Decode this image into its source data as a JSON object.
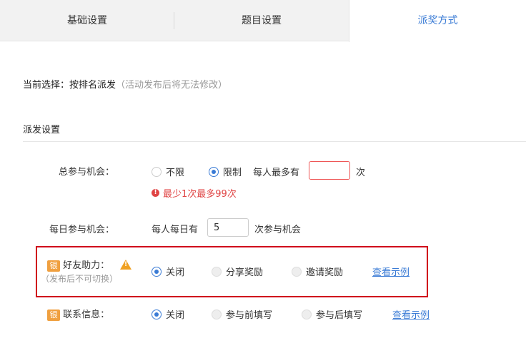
{
  "tabs": [
    "基础设置",
    "题目设置",
    "派奖方式"
  ],
  "current": {
    "prefix": "当前选择：按排名派发",
    "hint": "（活动发布后将无法修改）"
  },
  "section_title": "派发设置",
  "total": {
    "label": "总参与机会：",
    "opt_unlimited": "不限",
    "opt_limited": "限制",
    "per_person": "每人最多有",
    "value": "",
    "unit": "次",
    "error": "最少1次最多99次"
  },
  "daily": {
    "label": "每日参与机会：",
    "prefix": "每人每日有",
    "value": "5",
    "suffix": "次参与机会"
  },
  "friend": {
    "badge": "银",
    "label": "好友助力：",
    "sub": "（发布后不可切换）",
    "opts": [
      "关闭",
      "分享奖励",
      "邀请奖励"
    ],
    "link": "查看示例"
  },
  "contact": {
    "badge": "银",
    "label": "联系信息：",
    "opts": [
      "关闭",
      "参与前填写",
      "参与后填写"
    ],
    "link": "查看示例"
  },
  "colors": {
    "accent": "#3a7bd5",
    "error": "#e04545",
    "highlight": "#d0021b",
    "badge": "#f0a040"
  }
}
